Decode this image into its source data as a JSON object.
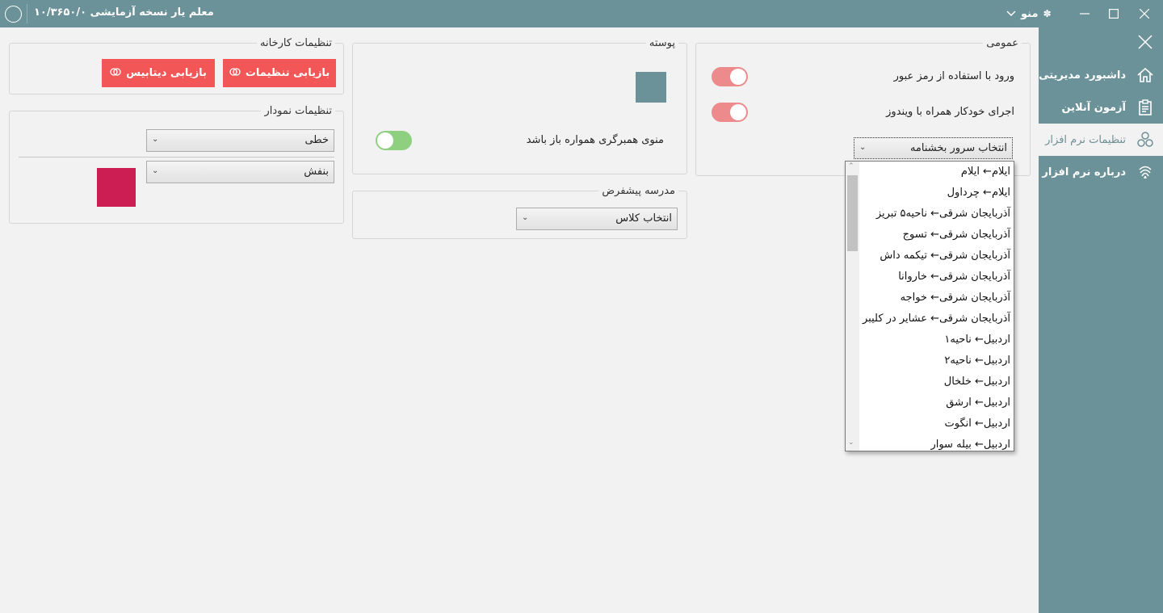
{
  "window": {
    "title": "معلم یار نسخه آزمایشی ۱۰/۳۶۵۰/۰",
    "menu_label": "منو"
  },
  "sidebar": {
    "items": [
      {
        "label": "داشبورد مدیریتی",
        "icon": "home-icon"
      },
      {
        "label": "آزمون آنلاین",
        "icon": "clipboard-icon"
      },
      {
        "label": "تنظیمات نرم افزار",
        "icon": "gears-icon"
      },
      {
        "label": "درباره نرم افزار",
        "icon": "fingerprint-icon"
      }
    ]
  },
  "general": {
    "title": "عمومی",
    "login_password_label": "ورود با استفاده از رمز عبور",
    "autostart_label": "اجرای خودکار همراه با ویندوز",
    "server_select": "انتخاب سرور بخشنامه"
  },
  "skin": {
    "title": "پوسته",
    "accent_color": "#6b9199",
    "menu_open_label": "منوی همبرگری همواره باز باشد"
  },
  "default_school": {
    "title": "مدرسه پیشفرض",
    "class_select": "انتخاب کلاس"
  },
  "factory": {
    "title": "تنظیمات کارخانه",
    "restore_settings": "بازیابی تنظیمات",
    "restore_database": "بازیابی دیتابیس"
  },
  "chart_settings": {
    "title": "تنظیمات نمودار",
    "chart_type": "خطی",
    "color_name": "بنفش",
    "color_value": "#cc1e52"
  },
  "server_dropdown": {
    "options": [
      "ایلام← ایلام",
      "ایلام← چرداول",
      "آذربایجان شرقی← ناحیه۵ تبریز",
      "آذربایجان شرقی← تسوج",
      "آذربایجان شرقی← تیکمه داش",
      "آذربایجان شرقی← خاروانا",
      "آذربایجان شرقی← خواجه",
      "آذربایجان شرقی← عشایر در کلیبر",
      "اردبیل← ناحیه۱",
      "اردبیل← ناحیه۲",
      "اردبیل← خلخال",
      "اردبیل← ارشق",
      "اردبیل← انگوت",
      "اردبیل← بیله سوار"
    ]
  },
  "colors": {
    "titlebar": "#6b9199",
    "toggle_on": "#ec8a8c",
    "toggle_off": "#8fcf80",
    "danger_button": "#f25656"
  }
}
